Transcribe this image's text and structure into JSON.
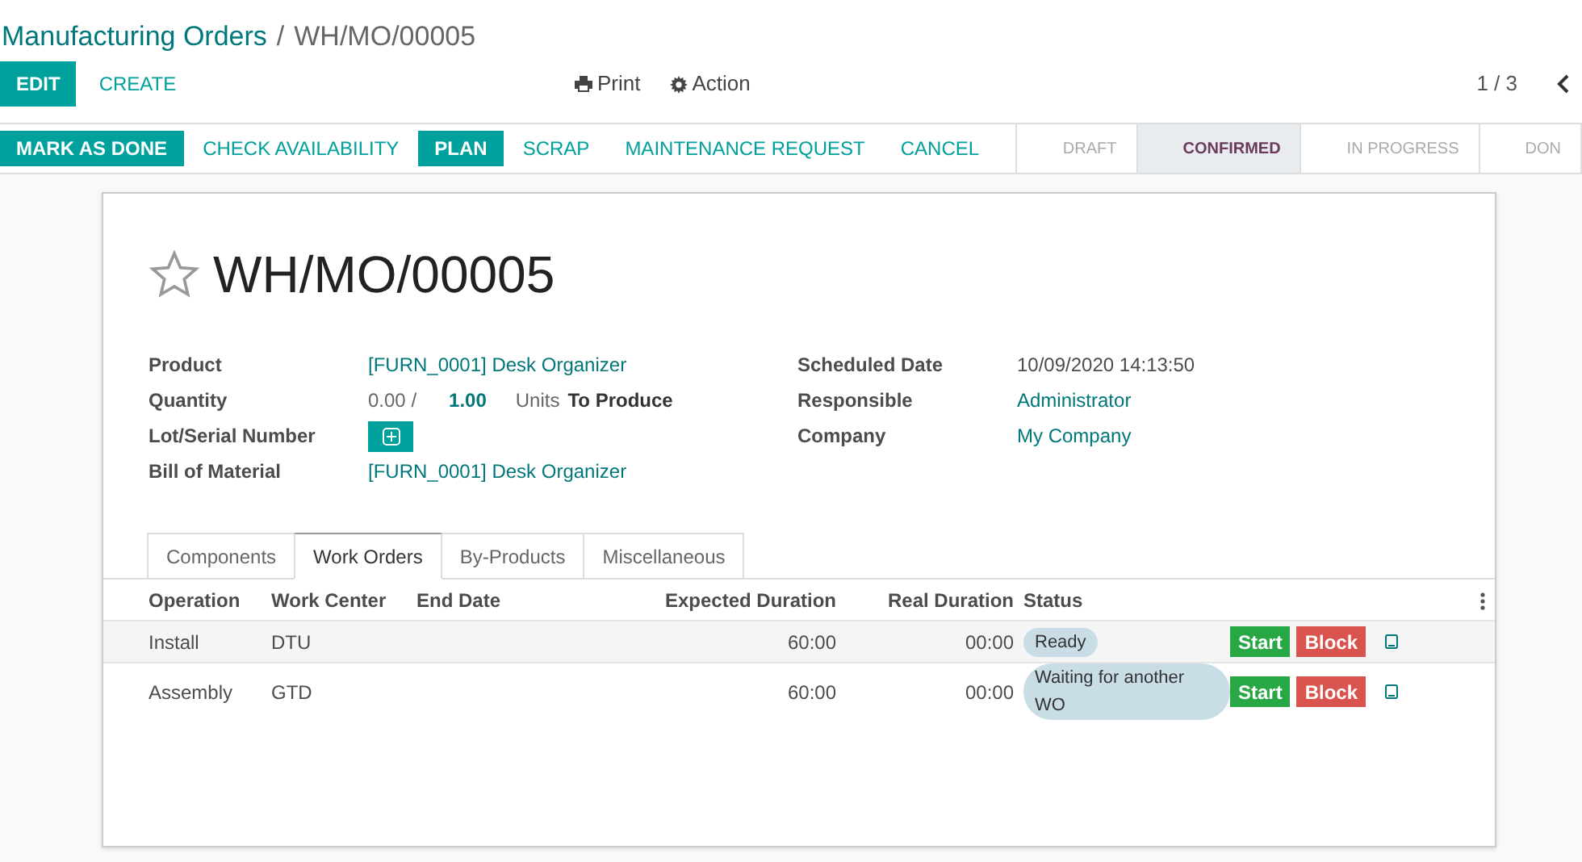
{
  "breadcrumb": {
    "parent": "Manufacturing Orders",
    "separator": "/",
    "current": "WH/MO/00005"
  },
  "control_buttons": [
    {
      "label": "EDIT",
      "kind": "primary"
    },
    {
      "label": "CREATE",
      "kind": "link"
    }
  ],
  "action_menus": [
    {
      "label": "Print",
      "kind": "print"
    },
    {
      "label": "Action",
      "kind": "gear"
    }
  ],
  "pager": "1 / 3",
  "header_buttons": [
    {
      "label": "MARK AS DONE",
      "kind": "primary"
    },
    {
      "label": "CHECK AVAILABILITY",
      "kind": "link"
    },
    {
      "label": "PLAN",
      "kind": "primary"
    },
    {
      "label": "SCRAP",
      "kind": "link"
    },
    {
      "label": "MAINTENANCE REQUEST",
      "kind": "link"
    },
    {
      "label": "CANCEL",
      "kind": "link"
    }
  ],
  "stages": [
    {
      "label": "DRAFT",
      "selected": false
    },
    {
      "label": "CONFIRMED",
      "selected": true
    },
    {
      "label": "IN PROGRESS",
      "selected": false
    },
    {
      "label": "DON",
      "selected": false
    }
  ],
  "record": {
    "title": "WH/MO/00005",
    "starred": false
  },
  "left_fields": [
    {
      "label": "Product",
      "kind": "link",
      "value": "[FURN_0001] Desk Organizer"
    },
    {
      "label": "Quantity",
      "kind": "quantity",
      "produced": "0.00 /",
      "planned": "1.00",
      "unit": "Units",
      "suffix": "To Produce"
    },
    {
      "label": "Lot/Serial Number",
      "kind": "add"
    },
    {
      "label": "Bill of Material",
      "kind": "link",
      "value": "[FURN_0001] Desk Organizer"
    }
  ],
  "right_fields": [
    {
      "label": "Scheduled Date",
      "kind": "text",
      "value": "10/09/2020 14:13:50"
    },
    {
      "label": "Responsible",
      "kind": "link",
      "value": "Administrator"
    },
    {
      "label": "Company",
      "kind": "link",
      "value": "My Company"
    }
  ],
  "tabs": [
    {
      "label": "Components",
      "selected": false
    },
    {
      "label": "Work Orders",
      "selected": true
    },
    {
      "label": "By-Products",
      "selected": false
    },
    {
      "label": "Miscellaneous",
      "selected": false
    }
  ],
  "table": {
    "columns": [
      "Operation",
      "Work Center",
      "End Date",
      "Expected Duration",
      "Real Duration",
      "Status"
    ],
    "rows": [
      {
        "operation": "Install",
        "work_center": "DTU",
        "expected": "60:00",
        "real": "00:00",
        "status": "Ready",
        "start": "Start",
        "block": "Block"
      },
      {
        "operation": "Assembly",
        "work_center": "GTD",
        "expected": "60:00",
        "real": "00:00",
        "status": "Waiting for another WO",
        "start": "Start",
        "block": "Block"
      }
    ]
  }
}
